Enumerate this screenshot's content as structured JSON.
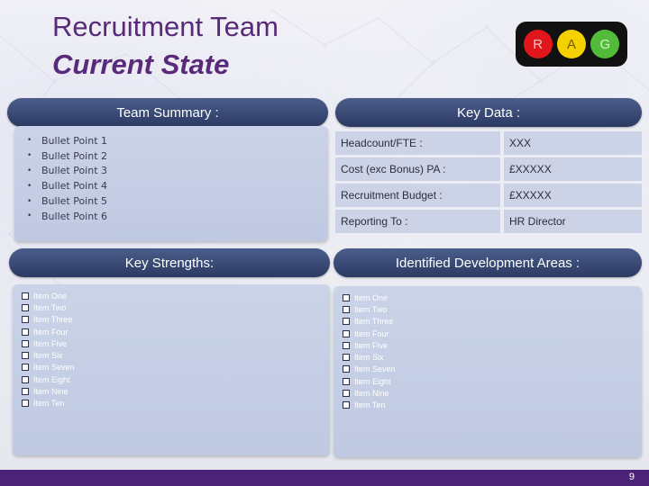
{
  "title": {
    "line1": "Recruitment Team",
    "line2": "Current State"
  },
  "rag": {
    "r": "R",
    "a": "A",
    "g": "G",
    "colors": {
      "r": "#e0161b",
      "a": "#f6d100",
      "g": "#52bb3a"
    }
  },
  "team_summary": {
    "header": "Team Summary :",
    "bullets": [
      "Bullet Point 1",
      "Bullet Point 2",
      "Bullet Point 3",
      "Bullet Point 4",
      "Bullet Point 5",
      "Bullet Point 6"
    ]
  },
  "key_data": {
    "header": "Key Data :",
    "rows": [
      {
        "label": "Headcount/FTE :",
        "value": "XXX"
      },
      {
        "label": "Cost (exc Bonus) PA :",
        "value": "£XXXXX"
      },
      {
        "label": "Recruitment Budget :",
        "value": "£XXXXX"
      },
      {
        "label": "Reporting To :",
        "value": "HR Director"
      }
    ]
  },
  "key_strengths": {
    "header": "Key Strengths:",
    "items": [
      "Item One",
      "Item Two",
      "Item Three",
      "Item Four",
      "Item Five",
      "Item Six",
      "Item Seven",
      "Item Eight",
      "Item Nine",
      "Item Ten"
    ]
  },
  "development_areas": {
    "header": "Identified Development Areas :",
    "items": [
      "Item One",
      "Item Two",
      "Item Three",
      "Item Four",
      "Item Five",
      "Item Six",
      "Item Seven",
      "Item Eight",
      "Item Nine",
      "Item Ten"
    ]
  },
  "footer": {
    "page_number": "9",
    "bar_color": "#4b2277"
  },
  "accent_color": "#5a2a7a"
}
